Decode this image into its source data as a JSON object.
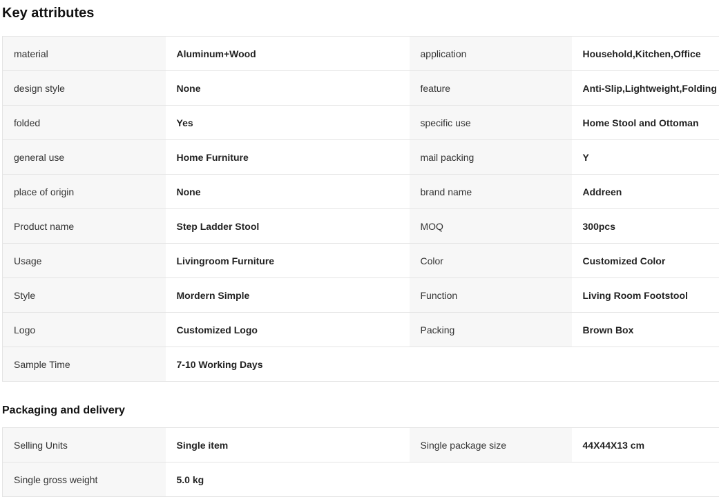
{
  "key_attributes": {
    "title": "Key attributes",
    "rows": [
      [
        {
          "label": "material",
          "value": "Aluminum+Wood"
        },
        {
          "label": "application",
          "value": "Household,Kitchen,Office"
        }
      ],
      [
        {
          "label": "design style",
          "value": "None"
        },
        {
          "label": "feature",
          "value": "Anti-Slip,Lightweight,Folding"
        }
      ],
      [
        {
          "label": "folded",
          "value": "Yes"
        },
        {
          "label": "specific use",
          "value": "Home Stool and Ottoman"
        }
      ],
      [
        {
          "label": "general use",
          "value": "Home Furniture"
        },
        {
          "label": "mail packing",
          "value": "Y"
        }
      ],
      [
        {
          "label": "place of origin",
          "value": "None"
        },
        {
          "label": "brand name",
          "value": "Addreen"
        }
      ],
      [
        {
          "label": "Product name",
          "value": "Step Ladder Stool"
        },
        {
          "label": "MOQ",
          "value": "300pcs"
        }
      ],
      [
        {
          "label": "Usage",
          "value": "Livingroom Furniture"
        },
        {
          "label": "Color",
          "value": "Customized Color"
        }
      ],
      [
        {
          "label": "Style",
          "value": "Mordern Simple"
        },
        {
          "label": "Function",
          "value": "Living Room Footstool"
        }
      ],
      [
        {
          "label": "Logo",
          "value": "Customized Logo"
        },
        {
          "label": "Packing",
          "value": "Brown Box"
        }
      ],
      [
        {
          "label": "Sample Time",
          "value": "7-10 Working Days"
        }
      ]
    ]
  },
  "packaging": {
    "title": "Packaging and delivery",
    "rows": [
      [
        {
          "label": "Selling Units",
          "value": "Single item"
        },
        {
          "label": "Single package size",
          "value": "44X44X13 cm"
        }
      ],
      [
        {
          "label": "Single gross weight",
          "value": "5.0 kg"
        }
      ]
    ]
  },
  "colors": {
    "label_bg": "#f7f7f7",
    "border": "#e4e4e4",
    "text": "#222222"
  }
}
